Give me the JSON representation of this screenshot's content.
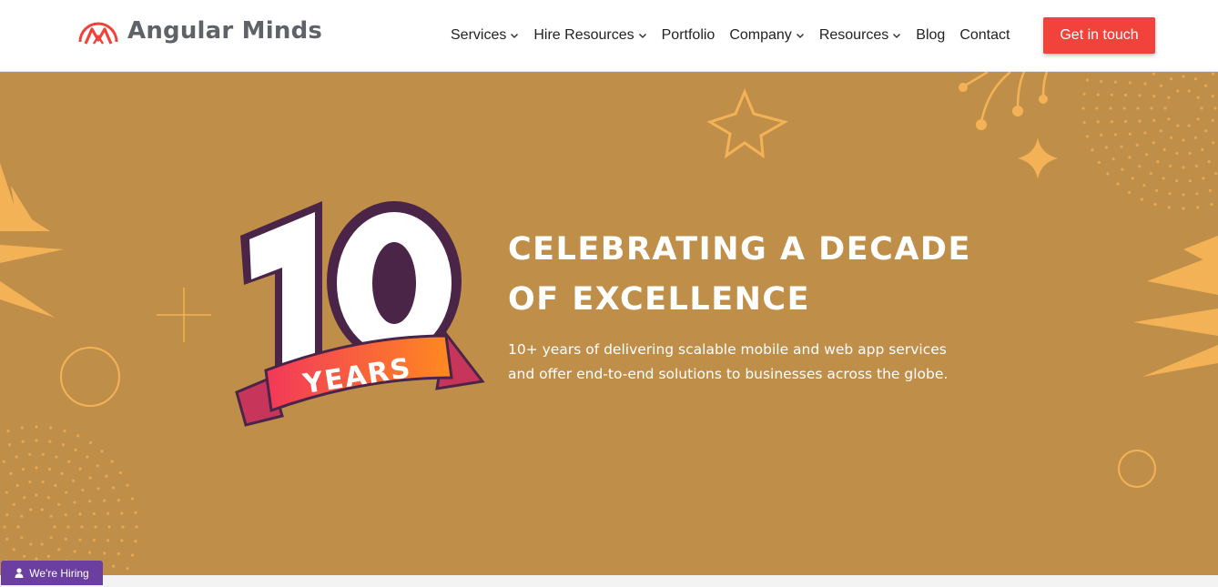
{
  "brand": {
    "name": "Angular Minds",
    "accent": "#f1423b"
  },
  "nav": {
    "items": [
      {
        "label": "Services",
        "dropdown": true
      },
      {
        "label": "Hire Resources",
        "dropdown": true
      },
      {
        "label": "Portfolio",
        "dropdown": false
      },
      {
        "label": "Company",
        "dropdown": true
      },
      {
        "label": "Resources",
        "dropdown": true
      },
      {
        "label": "Blog",
        "dropdown": false
      },
      {
        "label": "Contact",
        "dropdown": false
      }
    ],
    "cta_label": "Get in touch"
  },
  "hero": {
    "background": "#bf8f4a",
    "badge": {
      "number": "10",
      "ribbon_text": "YEARS"
    },
    "headline_line1": "CELEBRATING A DECADE",
    "headline_line2": "OF EXCELLENCE",
    "subtext_line1": "10+ years of delivering scalable mobile and web app services",
    "subtext_line2": "and offer end-to-end solutions to businesses across the globe."
  },
  "hiring_tab": {
    "label": "We're Hiring",
    "color": "#6b3fa0"
  },
  "icons": [
    "chevron-down-icon",
    "person-icon",
    "logo-mark-icon"
  ]
}
